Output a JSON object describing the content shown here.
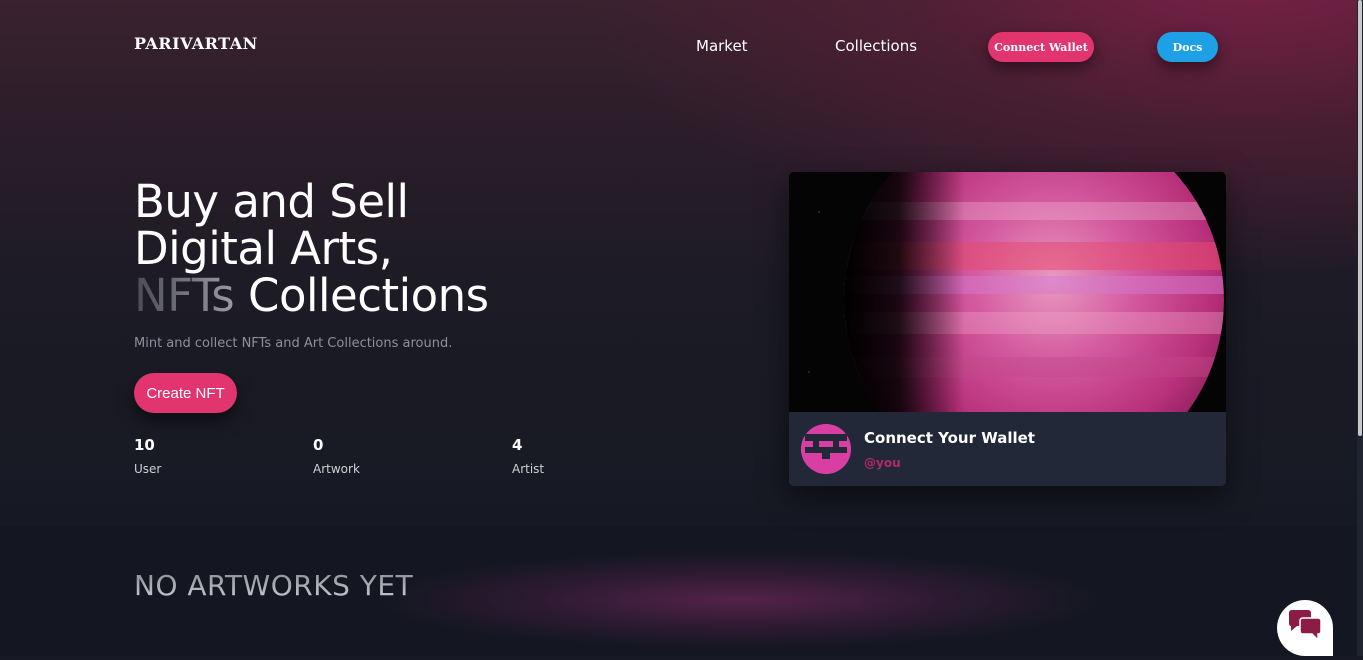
{
  "brand": {
    "name": "PARIVARTAN"
  },
  "nav": {
    "market": "Market",
    "collections": "Collections",
    "connect_wallet": "Connect Wallet",
    "docs": "Docs"
  },
  "hero": {
    "line1": "Buy and Sell",
    "line2": "Digital Arts,",
    "line3_muted": "NFTs",
    "line3_rest": " Collections",
    "subtitle": "Mint and collect NFTs and Art Collections around.",
    "create_button": "Create NFT",
    "stats": [
      {
        "value": "10",
        "label": "User"
      },
      {
        "value": "0",
        "label": "Artwork"
      },
      {
        "value": "4",
        "label": "Artist"
      }
    ]
  },
  "card": {
    "image_icon": "planet-image",
    "title": "Connect Your Wallet",
    "handle": "@you"
  },
  "section": {
    "title": "NO ARTWORKS YET"
  },
  "chat": {
    "icon": "chat-bubbles-icon"
  },
  "colors": {
    "accent_pink": "#e2356f",
    "accent_blue": "#1ea0e6",
    "card_bg": "#222837",
    "page_bg": "#171a24"
  }
}
